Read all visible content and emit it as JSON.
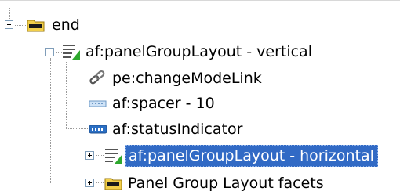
{
  "tree": {
    "nodes": [
      {
        "label": "end",
        "icon": "facet-folder-icon",
        "expanded": true
      },
      {
        "label": "af:panelGroupLayout - vertical",
        "icon": "panel-group-layout-icon",
        "expanded": true
      },
      {
        "label": "pe:changeModeLink",
        "icon": "link-icon"
      },
      {
        "label": "af:spacer - 10",
        "icon": "spacer-icon"
      },
      {
        "label": "af:statusIndicator",
        "icon": "status-indicator-icon"
      },
      {
        "label": "af:panelGroupLayout - horizontal",
        "icon": "panel-group-layout-icon",
        "expanded": false,
        "selected": true
      },
      {
        "label": "Panel Group Layout facets",
        "icon": "facet-folder-icon",
        "expanded": false
      }
    ]
  },
  "colors": {
    "selection": "#316ac5",
    "folder": "#f2cf4a",
    "layout_badge": "#2ea82e"
  }
}
